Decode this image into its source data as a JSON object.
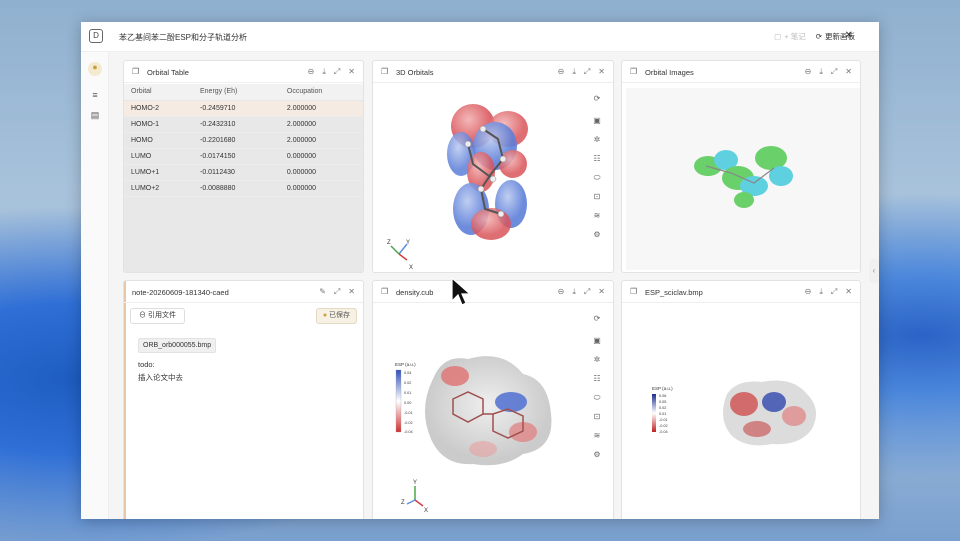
{
  "window": {
    "title": "苯乙基间苯二酚ESP和分子轨道分析",
    "add_note_label": "+ 笔记",
    "refresh_label": "更新画板",
    "logo": "D"
  },
  "sidebar": {
    "icons": [
      "palette-icon",
      "list-icon",
      "document-icon"
    ]
  },
  "panels": {
    "orbital_table": {
      "title": "Orbital Table",
      "columns": [
        "Orbital",
        "Energy (Eh)",
        "Occupation"
      ],
      "rows": [
        [
          "HOMO-2",
          "-0.2459710",
          "2.000000"
        ],
        [
          "HOMO-1",
          "-0.2432310",
          "2.000000"
        ],
        [
          "HOMO",
          "-0.2201680",
          "2.000000"
        ],
        [
          "LUMO",
          "-0.0174150",
          "0.000000"
        ],
        [
          "LUMO+1",
          "-0.0112430",
          "0.000000"
        ],
        [
          "LUMO+2",
          "-0.0088880",
          "0.000000"
        ]
      ]
    },
    "orbitals_3d": {
      "title": "3D Orbitals",
      "axis_labels": [
        "Z",
        "Y",
        "X"
      ]
    },
    "orbital_images": {
      "title": "Orbital Images"
    },
    "note": {
      "title": "note-20260609-181340-caed",
      "cite_label": "引用文件",
      "saved_label": "已保存",
      "chip": "ORB_orb000055.bmp",
      "line1": "todo:",
      "line2": "插入论文中去"
    },
    "density": {
      "title": "density.cub",
      "legend_title": "ESP (a.u.)",
      "legend_ticks": [
        "0.04",
        "0.02",
        "0.01",
        "0.00",
        "-0.01",
        "-0.02",
        "-0.04"
      ],
      "axis_labels": [
        "Y",
        "Z",
        "X"
      ]
    },
    "esp_sciclav": {
      "title": "ESP_sciclav.bmp",
      "legend_title": "ESP (a.u.)",
      "legend_ticks": [
        "0.06",
        "0.05",
        "0.02",
        "0.01",
        "-0.01",
        "-0.02",
        "-0.04"
      ]
    }
  }
}
